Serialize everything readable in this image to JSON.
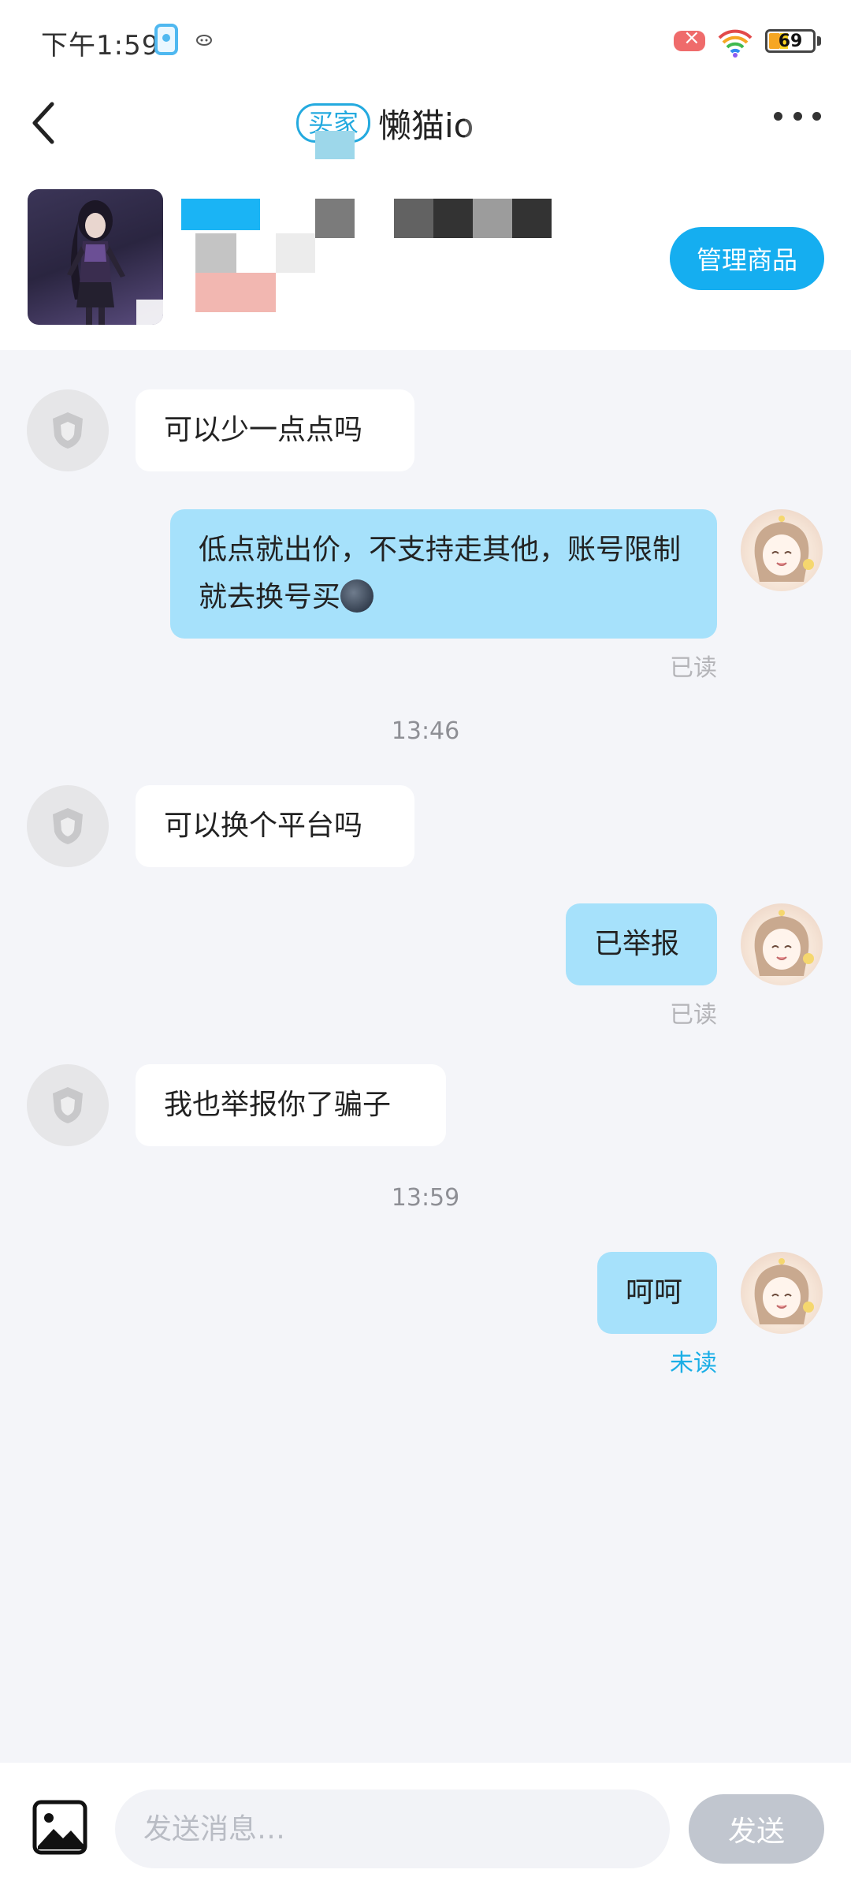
{
  "status_bar": {
    "time": "下午1:59",
    "battery_level": "69"
  },
  "header": {
    "role_tag": "买家",
    "nickname": "懒猫io",
    "manage_label": "管理商品"
  },
  "messages": [
    {
      "from": "other",
      "text": "可以少一点点吗"
    },
    {
      "from": "me",
      "text": "低点就出价，不支持走其他，账号限制就去换号买",
      "status": "已读"
    },
    {
      "from": "me",
      "text": "已举报",
      "status": "已读"
    },
    {
      "from": "other",
      "text": "可以换个平台吗"
    },
    {
      "from": "other",
      "text": "我也举报你了骗子"
    },
    {
      "from": "me",
      "text": "呵呵",
      "status": "未读"
    }
  ],
  "time_separators": [
    "13:46",
    "13:59"
  ],
  "input": {
    "placeholder": "发送消息…",
    "send_label": "发送"
  },
  "colors": {
    "accent": "#15aef0",
    "outgoing_bubble": "#a6e1fb",
    "incoming_bubble": "#ffffff",
    "chat_background": "#f4f5f9",
    "unread": "#1aaee6"
  },
  "icons": [
    "back-arrow-icon",
    "more-dots-icon",
    "image-icon",
    "signal-icon",
    "wifi-icon",
    "battery-icon"
  ]
}
